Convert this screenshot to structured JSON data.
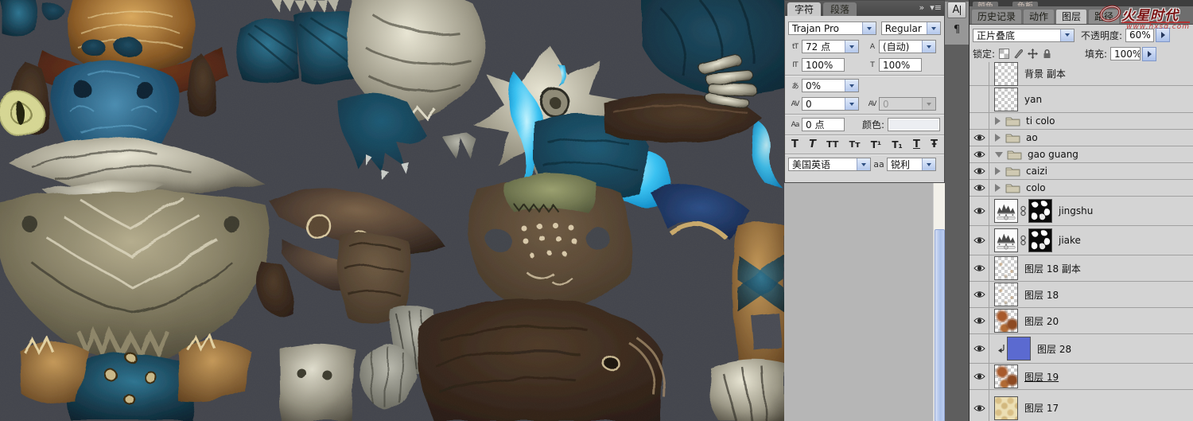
{
  "watermark": {
    "brand": "火星时代",
    "url": "www.hxsd.com"
  },
  "dock": {
    "character_icon_label": "A",
    "paragraph_icon_label": "¶"
  },
  "character_panel": {
    "tabs": [
      {
        "label": "字符",
        "active": true
      },
      {
        "label": "段落",
        "active": false
      }
    ],
    "collapse_icon": "»",
    "menu_icon": "▾≡",
    "font_family": "Trajan Pro",
    "font_style": "Regular",
    "font_size": "72 点",
    "leading": "(自动)",
    "vertical_scale": "100%",
    "horizontal_scale": "100%",
    "tsume": "0%",
    "kerning": "0",
    "tracking": "0",
    "baseline_shift": "0 点",
    "color_label": "颜色:",
    "language": "美国英语",
    "anti_alias_icon": "aa",
    "anti_alias": "锐利",
    "icons": {
      "size": "tT",
      "leading": "A",
      "v_scale": "IT",
      "h_scale": "T",
      "tsume": "あ",
      "kerning": "AV",
      "tracking": "AV",
      "baseline": "Aa"
    },
    "style_buttons": [
      {
        "id": "faux-bold",
        "glyph": "T"
      },
      {
        "id": "faux-italic",
        "glyph": "T"
      },
      {
        "id": "all-caps",
        "glyph": "TT"
      },
      {
        "id": "small-caps",
        "glyph": "Tᴛ"
      },
      {
        "id": "superscript",
        "glyph": "T¹"
      },
      {
        "id": "subscript",
        "glyph": "T₁"
      },
      {
        "id": "underline",
        "glyph": "T"
      },
      {
        "id": "strikethrough",
        "glyph": "Ŧ"
      }
    ]
  },
  "layers_panel": {
    "group_tabs_cut": [
      {
        "label": "颜色"
      },
      {
        "label": "色板"
      }
    ],
    "tabs": [
      {
        "label": "历史记录",
        "active": false
      },
      {
        "label": "动作",
        "active": false
      },
      {
        "label": "图层",
        "active": true
      },
      {
        "label": "路径",
        "active": false
      }
    ],
    "blend_mode": "正片叠底",
    "opacity_label": "不透明度:",
    "opacity_value": "60%",
    "lock_label": "锁定:",
    "fill_label": "填充:",
    "fill_value": "100%",
    "layers": [
      {
        "name": "背景 副本",
        "type": "image",
        "visible": false,
        "thumb": "checker"
      },
      {
        "name": "yan",
        "type": "image",
        "visible": false,
        "thumb": "checker"
      },
      {
        "name": "ti colo",
        "type": "group",
        "visible": false,
        "expanded": false
      },
      {
        "name": "ao",
        "type": "group",
        "visible": true,
        "expanded": false
      },
      {
        "name": "gao guang",
        "type": "group",
        "visible": true,
        "expanded": true
      },
      {
        "name": "caizi",
        "type": "group",
        "visible": true,
        "expanded": false
      },
      {
        "name": "colo",
        "type": "group",
        "visible": true,
        "expanded": false
      },
      {
        "name": "jingshu",
        "type": "adjustment",
        "visible": true
      },
      {
        "name": "jiake",
        "type": "adjustment",
        "visible": true
      },
      {
        "name": "图层 18 副本",
        "type": "image",
        "visible": true,
        "thumb": "speckle"
      },
      {
        "name": "图层 18",
        "type": "image",
        "visible": true,
        "thumb": "speckle"
      },
      {
        "name": "图层 20",
        "type": "image",
        "visible": true,
        "thumb": "rust"
      },
      {
        "name": "图层 28",
        "type": "image",
        "visible": true,
        "thumb": "blue",
        "clipped": true
      },
      {
        "name": "图层 19",
        "type": "image",
        "visible": true,
        "thumb": "rust",
        "underlined": true
      },
      {
        "name": "图层 17",
        "type": "image",
        "visible": true,
        "thumb": "cream"
      }
    ]
  }
}
